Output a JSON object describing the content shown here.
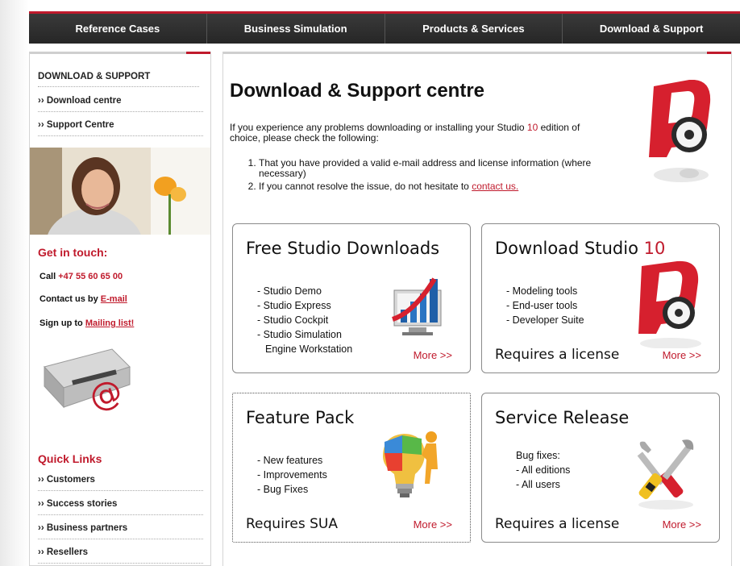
{
  "nav": {
    "tabs": [
      "Reference Cases",
      "Business Simulation",
      "Products & Services",
      "Download & Support"
    ]
  },
  "sidebar": {
    "heading": "DOWNLOAD & SUPPORT",
    "links": [
      "›› Download centre",
      "›› Support Centre"
    ],
    "get_in_touch": "Get in touch:",
    "call_label": "Call",
    "phone": "+47 55 60 65 00",
    "contact_label": "Contact us by",
    "email_link": "E-mail",
    "signup_label": "Sign up to",
    "mailing_link": "Mailing list!",
    "quick_links_title": "Quick Links",
    "quick_links": [
      "›› Customers",
      "›› Success stories",
      "›› Business partners",
      "›› Resellers"
    ]
  },
  "main": {
    "title": "Download & Support centre",
    "intro_before": "If you experience any problems downloading or installing your Studio",
    "intro_version": "10",
    "intro_after": "edition of choice, please check the following:",
    "steps": [
      "That you have provided a valid e-mail address and license information (where necessary)",
      "If you cannot resolve the issue, do not hesitate to"
    ],
    "contact_link": "contact us."
  },
  "boxes": [
    {
      "title": "Free Studio Downloads",
      "items": [
        "- Studio Demo",
        "- Studio Express",
        "- Studio Cockpit",
        "- Studio Simulation",
        "  Engine Workstation"
      ],
      "more": "More >>",
      "footer": ""
    },
    {
      "title": "Download Studio",
      "title_num": "10",
      "items": [
        "- Modeling tools",
        "- End-user tools",
        "- Developer Suite"
      ],
      "more": "More >>",
      "footer": "Requires a license"
    },
    {
      "title": "Feature Pack",
      "items": [
        "- New features",
        "- Improvements",
        "- Bug Fixes"
      ],
      "more": "More >>",
      "footer": "Requires SUA"
    },
    {
      "title": "Service Release",
      "items": [
        "Bug fixes:",
        "- All editions",
        "- All users"
      ],
      "more": "More >>",
      "footer": "Requires a license"
    }
  ],
  "colors": {
    "accent": "#c01a2c",
    "nav_bg": "#2e2e2e"
  }
}
